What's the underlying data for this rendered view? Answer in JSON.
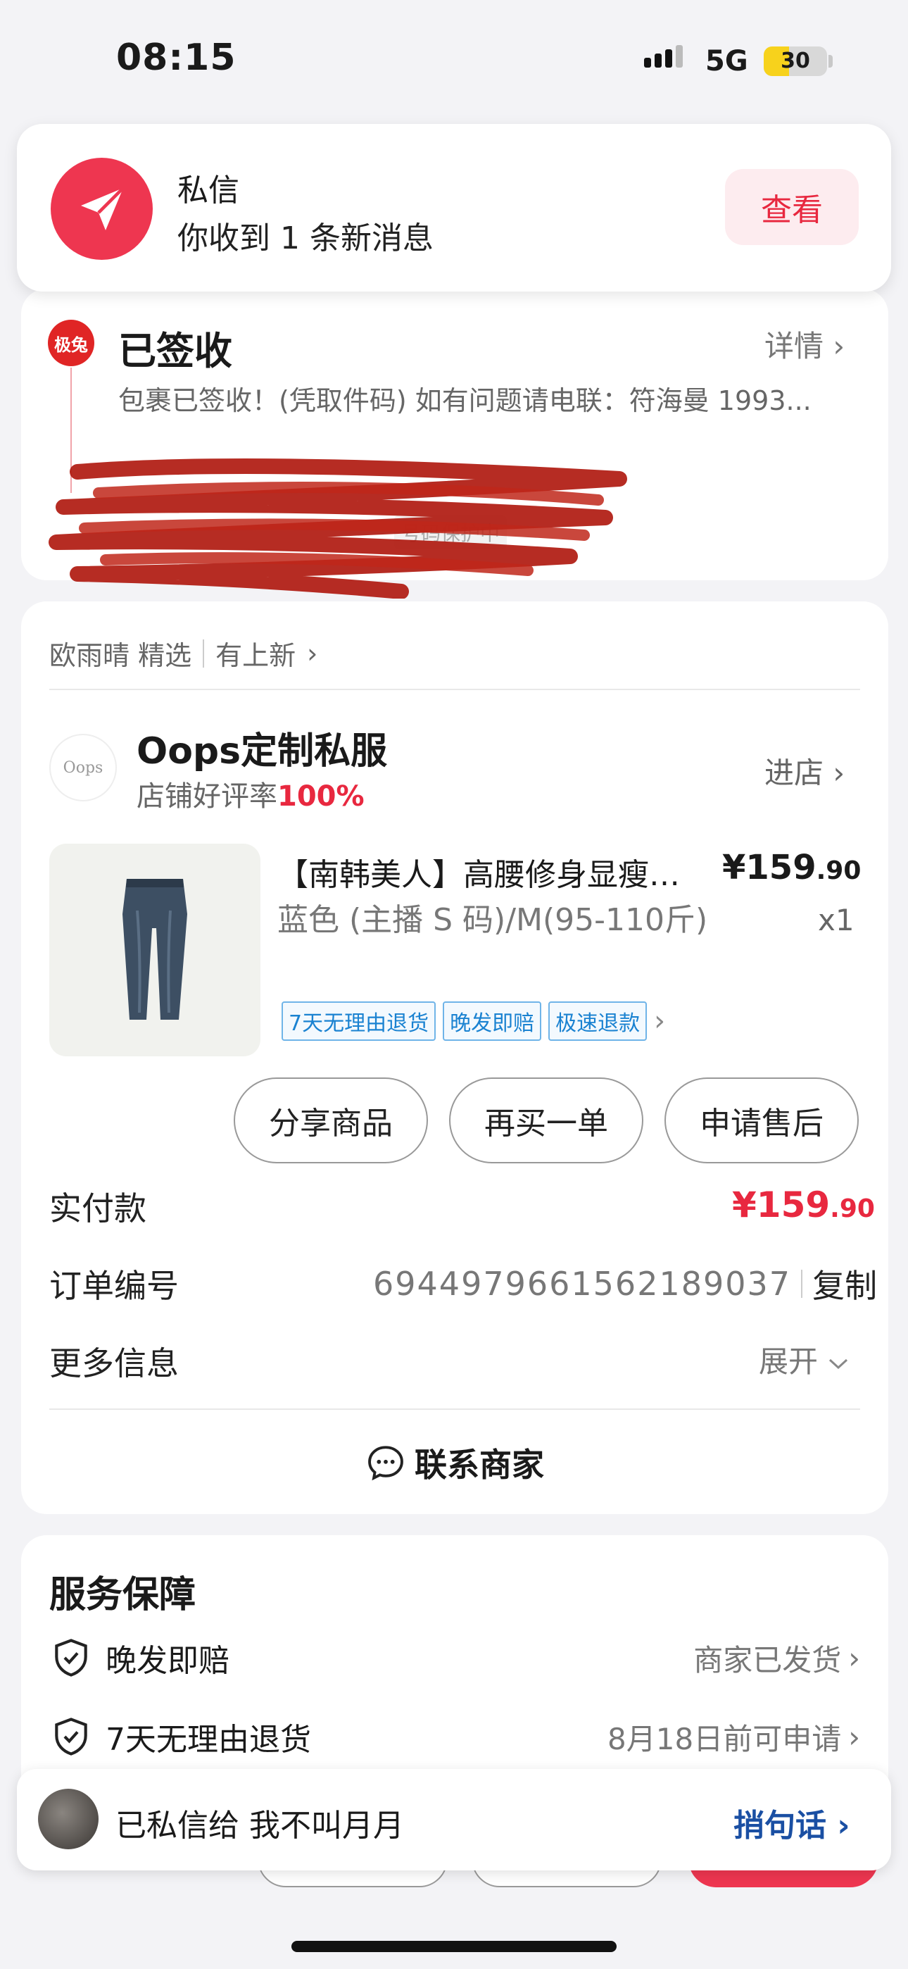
{
  "status_bar": {
    "time": "08:15",
    "network": "5G",
    "battery": "30"
  },
  "notification": {
    "title": "私信",
    "message": "你收到 1 条新消息",
    "button": "查看"
  },
  "delivery": {
    "carrier": "极兔",
    "status": "已签收",
    "detail_link": "详情",
    "text": "包裹已签收！(凭取件码) 如有问题请电联：符海曼 1993...",
    "privacy_tag": "号码保护中"
  },
  "order": {
    "shop_line": {
      "text": "欧雨晴 精选",
      "link": "有上新"
    },
    "shop": {
      "logo": "Oops",
      "name": "Oops定制私服",
      "rate_label": "店铺好评率",
      "rate_value": "100%",
      "enter": "进店"
    },
    "product": {
      "title": "【南韩美人】高腰修身显瘦牛仔裤",
      "price_main": "¥159",
      "price_decimal": ".90",
      "spec": "蓝色 (主播 S 码)/M(95-110斤)",
      "qty": "x1",
      "tags": [
        "7天无理由退货",
        "晚发即赔",
        "极速退款"
      ]
    },
    "actions": [
      "分享商品",
      "再买一单",
      "申请售后"
    ],
    "paid_label": "实付款",
    "paid_main": "¥159",
    "paid_decimal": ".90",
    "order_no_label": "订单编号",
    "order_no": "6944979661562189037",
    "copy": "复制",
    "more_label": "更多信息",
    "expand": "展开",
    "contact": "联系商家"
  },
  "service": {
    "title": "服务保障",
    "items": [
      {
        "name": "晚发即赔",
        "status": "商家已发货"
      },
      {
        "name": "7天无理由退货",
        "status": "8月18日前可申请"
      }
    ]
  },
  "toast": {
    "text": "已私信给 我不叫月月",
    "link": "捎句话"
  },
  "colors": {
    "accent_red": "#e8283f",
    "link_blue": "#1a4fa3",
    "tag_blue": "#1a82d1"
  }
}
